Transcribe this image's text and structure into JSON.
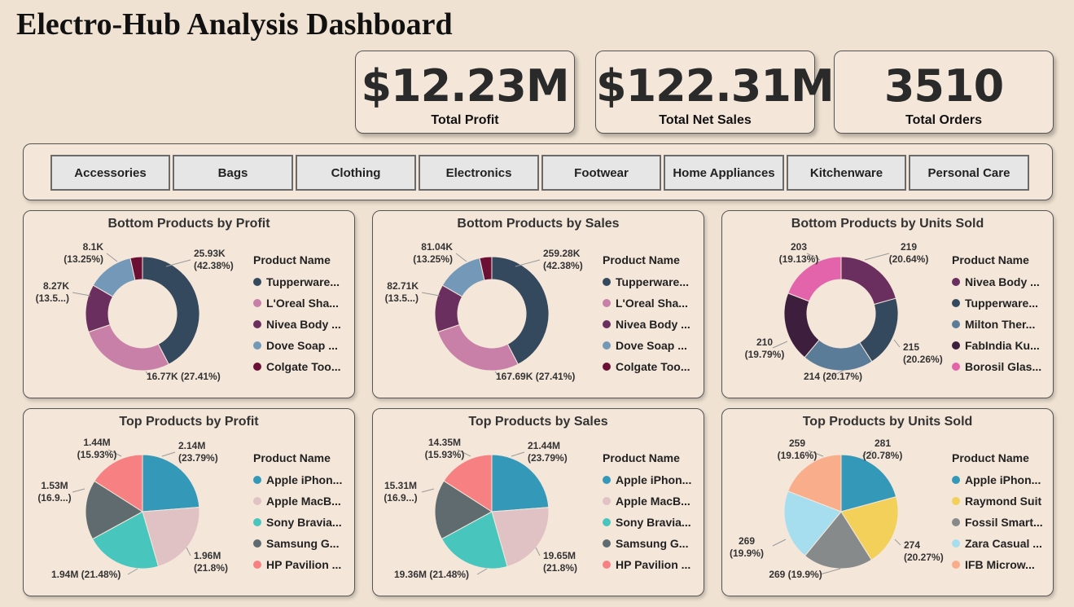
{
  "title": "Electro-Hub Analysis Dashboard",
  "kpis": [
    {
      "value": "$12.23M",
      "label": "Total Profit"
    },
    {
      "value": "$122.31M",
      "label": "Total Net Sales"
    },
    {
      "value": "3510",
      "label": "Total Orders"
    }
  ],
  "categories": [
    "Accessories",
    "Bags",
    "Clothing",
    "Electronics",
    "Footwear",
    "Home Appliances",
    "Kitchenware",
    "Personal Care"
  ],
  "panels": [
    {
      "title": "Bottom Products by Profit",
      "legend_title": "Product Name",
      "type": "donut",
      "items": [
        {
          "name": "Tupperware...",
          "color": "#34495e"
        },
        {
          "name": "L'Oreal Sha...",
          "color": "#c87fa8"
        },
        {
          "name": "Nivea Body ...",
          "color": "#6a2f5e"
        },
        {
          "name": "Dove Soap ...",
          "color": "#7499b8"
        },
        {
          "name": "Colgate Too...",
          "color": "#6b0f35"
        }
      ],
      "labels": [
        {
          "line1": "25.93K",
          "line2": "(42.38%)"
        },
        {
          "line1": "16.77K (27.41%)",
          "line2": ""
        },
        {
          "line1": "8.27K",
          "line2": "(13.5...)"
        },
        {
          "line1": "8.1K",
          "line2": "(13.25%)"
        }
      ]
    },
    {
      "title": "Bottom Products by Sales",
      "legend_title": "Product Name",
      "type": "donut",
      "items": [
        {
          "name": "Tupperware...",
          "color": "#34495e"
        },
        {
          "name": "L'Oreal Sha...",
          "color": "#c87fa8"
        },
        {
          "name": "Nivea Body ...",
          "color": "#6a2f5e"
        },
        {
          "name": "Dove Soap ...",
          "color": "#7499b8"
        },
        {
          "name": "Colgate Too...",
          "color": "#6b0f35"
        }
      ],
      "labels": [
        {
          "line1": "259.28K",
          "line2": "(42.38%)"
        },
        {
          "line1": "167.69K (27.41%)",
          "line2": ""
        },
        {
          "line1": "82.71K",
          "line2": "(13.5...)"
        },
        {
          "line1": "81.04K",
          "line2": "(13.25%)"
        }
      ]
    },
    {
      "title": "Bottom Products by Units Sold",
      "legend_title": "Product Name",
      "type": "donut",
      "items": [
        {
          "name": "Nivea Body ...",
          "color": "#6a2f5e"
        },
        {
          "name": "Tupperware...",
          "color": "#34495e"
        },
        {
          "name": "Milton Ther...",
          "color": "#5b7c99"
        },
        {
          "name": "FabIndia Ku...",
          "color": "#3d1f3d"
        },
        {
          "name": "Borosil Glas...",
          "color": "#e464ac"
        }
      ],
      "labels": [
        {
          "line1": "219",
          "line2": "(20.64%)"
        },
        {
          "line1": "215",
          "line2": "(20.26%)"
        },
        {
          "line1": "214 (20.17%)",
          "line2": ""
        },
        {
          "line1": "210",
          "line2": "(19.79%)"
        },
        {
          "line1": "203",
          "line2": "(19.13%)"
        }
      ]
    },
    {
      "title": "Top Products by Profit",
      "legend_title": "Product Name",
      "type": "pie",
      "items": [
        {
          "name": "Apple iPhon...",
          "color": "#3498b8"
        },
        {
          "name": "Apple MacB...",
          "color": "#e0c2c4"
        },
        {
          "name": "Sony Bravia...",
          "color": "#48c6be"
        },
        {
          "name": "Samsung G...",
          "color": "#5f6b6e"
        },
        {
          "name": "HP Pavilion ...",
          "color": "#f78182"
        }
      ],
      "labels": [
        {
          "line1": "2.14M",
          "line2": "(23.79%)"
        },
        {
          "line1": "1.96M",
          "line2": "(21.8%)"
        },
        {
          "line1": "1.94M (21.48%)",
          "line2": ""
        },
        {
          "line1": "1.53M",
          "line2": "(16.9...)"
        },
        {
          "line1": "1.44M",
          "line2": "(15.93%)"
        }
      ]
    },
    {
      "title": "Top Products by Sales",
      "legend_title": "Product Name",
      "type": "pie",
      "items": [
        {
          "name": "Apple iPhon...",
          "color": "#3498b8"
        },
        {
          "name": "Apple MacB...",
          "color": "#e0c2c4"
        },
        {
          "name": "Sony Bravia...",
          "color": "#48c6be"
        },
        {
          "name": "Samsung G...",
          "color": "#5f6b6e"
        },
        {
          "name": "HP Pavilion ...",
          "color": "#f78182"
        }
      ],
      "labels": [
        {
          "line1": "21.44M",
          "line2": "(23.79%)"
        },
        {
          "line1": "19.65M",
          "line2": "(21.8%)"
        },
        {
          "line1": "19.36M (21.48%)",
          "line2": ""
        },
        {
          "line1": "15.31M",
          "line2": "(16.9...)"
        },
        {
          "line1": "14.35M",
          "line2": "(15.93%)"
        }
      ]
    },
    {
      "title": "Top Products by Units Sold",
      "legend_title": "Product Name",
      "type": "pie",
      "items": [
        {
          "name": "Apple iPhon...",
          "color": "#3498b8"
        },
        {
          "name": "Raymond Suit",
          "color": "#f2d05a"
        },
        {
          "name": "Fossil Smart...",
          "color": "#868a8a"
        },
        {
          "name": "Zara Casual ...",
          "color": "#a6def0"
        },
        {
          "name": "IFB Microw...",
          "color": "#f9ad8a"
        }
      ],
      "labels": [
        {
          "line1": "281",
          "line2": "(20.78%)"
        },
        {
          "line1": "274",
          "line2": "(20.27%)"
        },
        {
          "line1": "269 (19.9%)",
          "line2": ""
        },
        {
          "line1": "269",
          "line2": "(19.9%)"
        },
        {
          "line1": "259",
          "line2": "(19.16%)"
        }
      ]
    }
  ],
  "chart_data": [
    {
      "type": "pie",
      "title": "Bottom Products by Profit",
      "categories": [
        "Tupperware...",
        "L'Oreal Sha...",
        "Nivea Body ...",
        "Dove Soap ...",
        "Colgate Too..."
      ],
      "values": [
        25.93,
        16.77,
        8.27,
        8.1,
        2.11
      ]
    },
    {
      "type": "pie",
      "title": "Bottom Products by Sales",
      "categories": [
        "Tupperware...",
        "L'Oreal Sha...",
        "Nivea Body ...",
        "Dove Soap ...",
        "Colgate Too..."
      ],
      "values": [
        259.28,
        167.69,
        82.71,
        81.04,
        21.1
      ]
    },
    {
      "type": "pie",
      "title": "Bottom Products by Units Sold",
      "categories": [
        "Nivea Body ...",
        "Tupperware...",
        "Milton Ther...",
        "FabIndia Ku...",
        "Borosil Glas..."
      ],
      "values": [
        219,
        215,
        214,
        210,
        203
      ]
    },
    {
      "type": "pie",
      "title": "Top Products by Profit",
      "categories": [
        "Apple iPhon...",
        "Apple MacB...",
        "Sony Bravia...",
        "Samsung G...",
        "HP Pavilion ..."
      ],
      "values": [
        2.14,
        1.96,
        1.94,
        1.53,
        1.44
      ]
    },
    {
      "type": "pie",
      "title": "Top Products by Sales",
      "categories": [
        "Apple iPhon...",
        "Apple MacB...",
        "Sony Bravia...",
        "Samsung G...",
        "HP Pavilion ..."
      ],
      "values": [
        21.44,
        19.65,
        19.36,
        15.31,
        14.35
      ]
    },
    {
      "type": "pie",
      "title": "Top Products by Units Sold",
      "categories": [
        "Apple iPhon...",
        "Raymond Suit",
        "Fossil Smart...",
        "Zara Casual ...",
        "IFB Microw..."
      ],
      "values": [
        281,
        274,
        269,
        269,
        259
      ]
    }
  ]
}
